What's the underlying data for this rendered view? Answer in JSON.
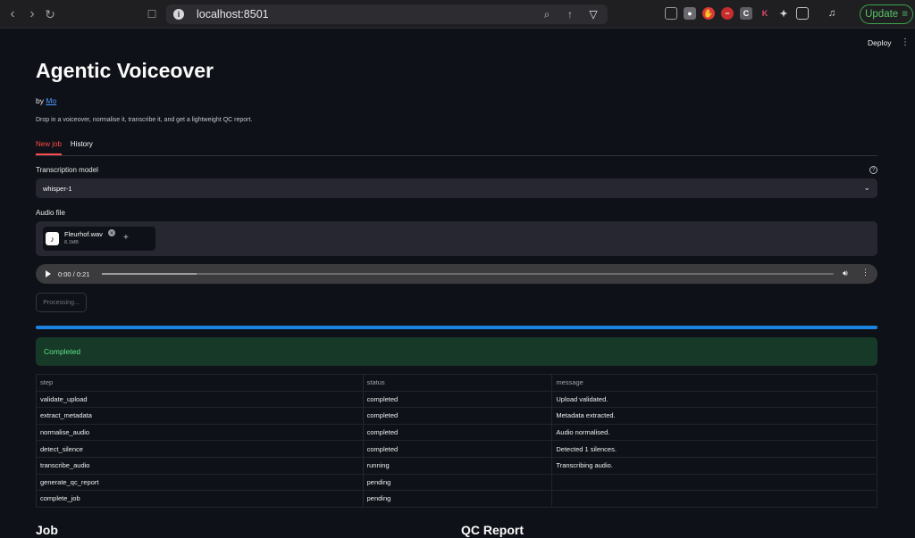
{
  "browser": {
    "url": "localhost:8501",
    "update_label": "Update"
  },
  "app": {
    "deploy_label": "Deploy",
    "title": "Agentic Voiceover",
    "by_prefix": "by",
    "author": "Mo",
    "description": "Drop in a voiceover, normalise it, transcribe it, and get a lightweight QC report."
  },
  "tabs": [
    {
      "label": "New job",
      "active": true
    },
    {
      "label": "History",
      "active": false
    }
  ],
  "model": {
    "label": "Transcription model",
    "value": "whisper-1"
  },
  "audio": {
    "label": "Audio file",
    "file_name": "Fleurhof.wav",
    "file_size": "8.1MB",
    "time": "0:00 / 0:21",
    "playback_progress": 0.13
  },
  "processing_label": "Processing...",
  "progress": 1.0,
  "status_message": "Completed",
  "steps_table": {
    "columns": [
      "step",
      "status",
      "message"
    ],
    "rows": [
      [
        "validate_upload",
        "completed",
        "Upload validated."
      ],
      [
        "extract_metadata",
        "completed",
        "Metadata extracted."
      ],
      [
        "normalise_audio",
        "completed",
        "Audio normalised."
      ],
      [
        "detect_silence",
        "completed",
        "Detected 1 silences."
      ],
      [
        "transcribe_audio",
        "running",
        "Transcribing audio."
      ],
      [
        "generate_qc_report",
        "pending",
        ""
      ],
      [
        "complete_job",
        "pending",
        ""
      ]
    ]
  },
  "sections": {
    "job": "Job",
    "qc_report": "QC Report"
  },
  "colors": {
    "accent": "#ff4b4b",
    "link": "#4d9bff",
    "progress": "#1c83e1",
    "success_bg": "#173928",
    "success_text": "#5ce488"
  }
}
